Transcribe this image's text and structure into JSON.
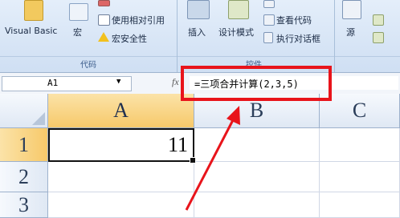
{
  "ribbon": {
    "visual_basic": "Visual Basic",
    "macros": "宏",
    "relative_ref": "使用相对引用",
    "macro_security": "宏安全性",
    "code_group": "代码",
    "insert": "插入",
    "design_mode": "设计模式",
    "view_code": "查看代码",
    "run_dialog": "执行对话框",
    "controls_group": "控件",
    "source": "源"
  },
  "formula_bar": {
    "name_box": "A1",
    "fx": "fx",
    "formula": "=三项合并计算(2,3,5)"
  },
  "sheet": {
    "columns": [
      "A",
      "B",
      "C"
    ],
    "rows": [
      "1",
      "2",
      "3"
    ],
    "cell_a1": "11"
  },
  "colors": {
    "highlight_box": "#e8141b",
    "arrow": "#e8141b",
    "selected_header": "#f7c96a"
  }
}
